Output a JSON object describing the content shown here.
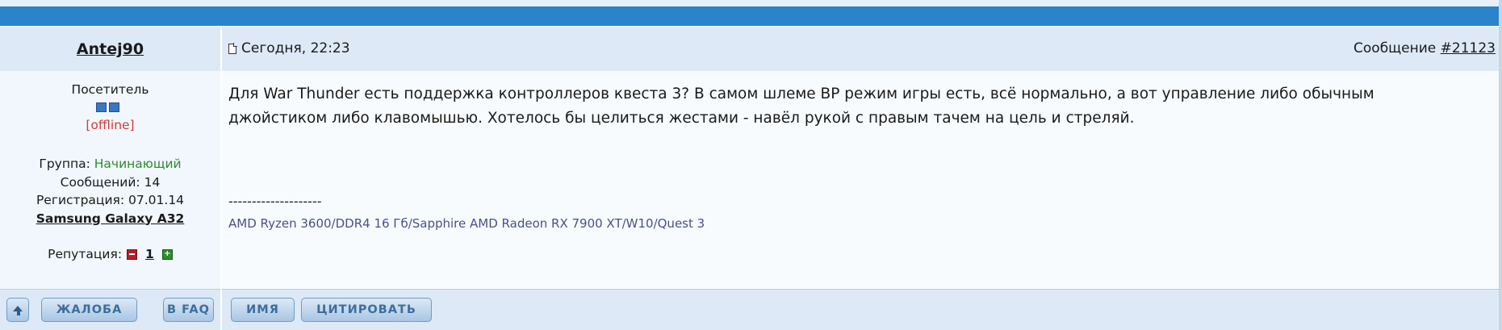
{
  "post": {
    "author": "Antej90",
    "date": "Сегодня, 22:23",
    "message_label": "Сообщение",
    "message_number": "#21123",
    "status": "Посетитель",
    "online_state": "[offline]",
    "group_label": "Группа:",
    "group_value": "Начинающий",
    "posts_label": "Сообщений: 14",
    "registered_label": "Регистрация: 07.01.14",
    "device": "Samsung Galaxy A32",
    "reputation_label": "Репутация:",
    "reputation_value": "1",
    "text": "Для War Thunder есть поддержка контроллеров квеста 3? В самом шлеме ВР режим игры есть, всё нормально, а вот управление либо обычным джойстиком либо клавомышью. Хотелось бы целиться жестами - навёл рукой с правым тачем на цель и стреляй.",
    "signature_separator": "--------------------",
    "signature": "AMD Ryzen 3600/DDR4 16 Гб/Sapphire AMD Radeon RX 7900 XT/W10/Quest 3"
  },
  "buttons": {
    "complaint": "ЖАЛОБА",
    "to_faq": "В FAQ",
    "name": "ИМЯ",
    "quote": "ЦИТИРОВАТЬ"
  },
  "icons": {
    "doc": "document-icon",
    "up": "arrow-up-icon",
    "rep_minus": "minus-icon",
    "rep_plus": "plus-icon"
  },
  "colors": {
    "top_bar": "#2a84cc",
    "header_bg": "#dde9f6",
    "offline": "#d23a3a",
    "group": "#2f8a2f",
    "signature": "#4a4f8a"
  }
}
